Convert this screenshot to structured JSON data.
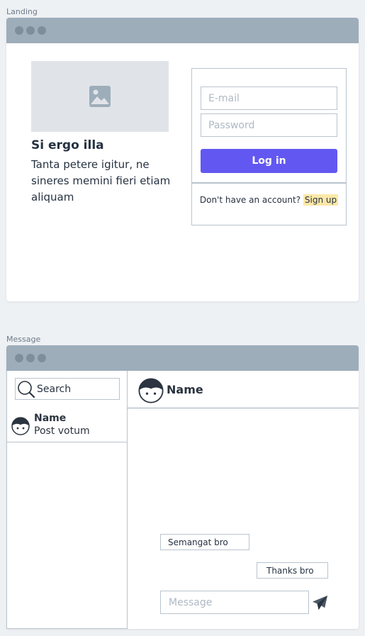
{
  "landing": {
    "section_label": "Landing",
    "hero_title": "Si ergo illa",
    "hero_text": "Tanta petere igitur, ne sineres memini fieri etiam aliquam",
    "email_placeholder": "E-mail",
    "password_placeholder": "Password",
    "login_label": "Log in",
    "account_prompt": "Don't have an account?",
    "signup_label": "Sign up",
    "icons": {
      "image": "image-placeholder-icon"
    }
  },
  "message": {
    "section_label": "Message",
    "search_placeholder": "Search",
    "contact": {
      "name": "Name",
      "preview": "Post votum"
    },
    "chat_header_name": "Name",
    "bubbles": [
      "Semangat bro",
      "Thanks bro"
    ],
    "input_placeholder": "Message",
    "icons": {
      "search": "search-icon",
      "avatar": "avatar-icon",
      "send": "send-icon"
    }
  },
  "colors": {
    "accent": "#6258f1",
    "titlebar": "#9eadba",
    "border": "#b9c4ce",
    "highlight": "#fde8a8",
    "background": "#eef1f4"
  }
}
